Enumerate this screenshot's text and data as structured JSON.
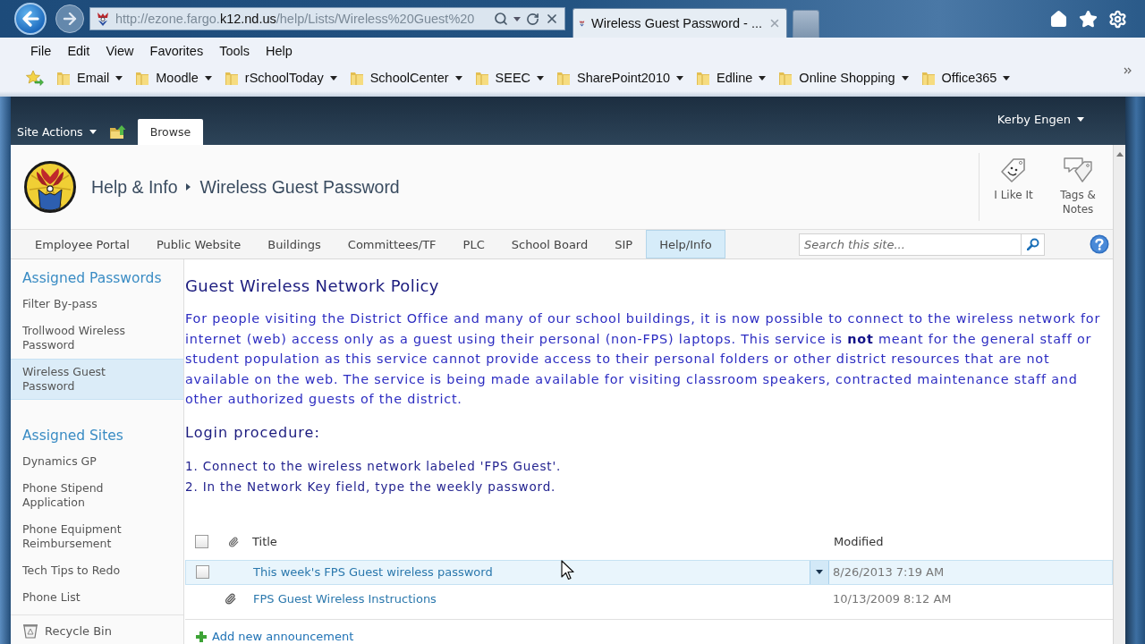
{
  "browser": {
    "address_bar": {
      "url_parts": [
        {
          "text": "http://ezone.fargo.",
          "emphasized": false
        },
        {
          "text": "k12.nd.us",
          "emphasized": true
        },
        {
          "text": "/help/Lists/Wireless%20Guest%20",
          "emphasized": false
        }
      ]
    },
    "tabs": [
      {
        "title": "Wireless Guest Password - ...",
        "selected": true
      }
    ],
    "menu": [
      "File",
      "Edit",
      "View",
      "Favorites",
      "Tools",
      "Help"
    ],
    "favorites": [
      "Email",
      "Moodle",
      "rSchoolToday",
      "SchoolCenter",
      "SEEC",
      "SharePoint2010",
      "Edline",
      "Online Shopping",
      "Office365"
    ]
  },
  "ribbon": {
    "site_actions": "Site Actions",
    "tabs": [
      {
        "label": "Browse",
        "selected": true
      }
    ],
    "user": "Kerby Engen"
  },
  "title_area": {
    "breadcrumb": [
      "Help & Info",
      "Wireless Guest Password"
    ],
    "social": [
      {
        "label": "I Like It",
        "kind": "like"
      },
      {
        "label": "Tags & Notes",
        "kind": "tags"
      }
    ]
  },
  "top_nav": {
    "items": [
      {
        "label": "Employee Portal",
        "selected": false
      },
      {
        "label": "Public Website",
        "selected": false
      },
      {
        "label": "Buildings",
        "selected": false
      },
      {
        "label": "Committees/TF",
        "selected": false
      },
      {
        "label": "PLC",
        "selected": false
      },
      {
        "label": "School Board",
        "selected": false
      },
      {
        "label": "SIP",
        "selected": false
      },
      {
        "label": "Help/Info",
        "selected": true
      }
    ],
    "search": {
      "placeholder": "Search this site..."
    }
  },
  "left_nav": {
    "sections": [
      {
        "heading": "Assigned Passwords",
        "items": [
          {
            "label": "Filter By-pass",
            "selected": false
          },
          {
            "label": "Trollwood Wireless Password",
            "selected": false
          },
          {
            "label": "Wireless Guest Password",
            "selected": true
          }
        ]
      },
      {
        "heading": "Assigned Sites",
        "items": [
          {
            "label": "Dynamics GP",
            "selected": false
          },
          {
            "label": "Phone Stipend Application",
            "selected": false
          },
          {
            "label": "Phone Equipment Reimbursement",
            "selected": false
          },
          {
            "label": "Tech Tips to Redo",
            "selected": false
          },
          {
            "label": "Phone List",
            "selected": false
          }
        ]
      }
    ],
    "recycle_bin": "Recycle Bin"
  },
  "content": {
    "heading": "Guest Wireless Network Policy",
    "paragraph": "For people visiting the District Office and many of our school buildings, it is now possible to connect to the wireless network for internet (web) access only as a guest using their personal (non-FPS) laptops. This service is **not** meant for the general staff or student population as this service cannot provide access to their personal folders or other district resources that are not available on the web. The service is being made available for visiting classroom speakers, contracted maintenance staff and other authorized guests of the district.",
    "subheading": "Login procedure:",
    "steps": [
      "1. Connect to the wireless network labeled 'FPS Guest'.",
      "2. In the Network Key field, type the weekly password."
    ]
  },
  "list": {
    "select_all": {
      "checked": false
    },
    "columns": [
      "Title",
      "Modified"
    ],
    "rows": [
      {
        "title": "This week's FPS Guest wireless password",
        "modified": "8/26/2013 7:19 AM",
        "attachment": false,
        "highlighted": true,
        "checked": false
      },
      {
        "title": "FPS Guest Wireless Instructions",
        "modified": "10/13/2009 8:12 AM",
        "attachment": true,
        "highlighted": false,
        "checked": false
      }
    ],
    "add_link": "Add new announcement"
  }
}
